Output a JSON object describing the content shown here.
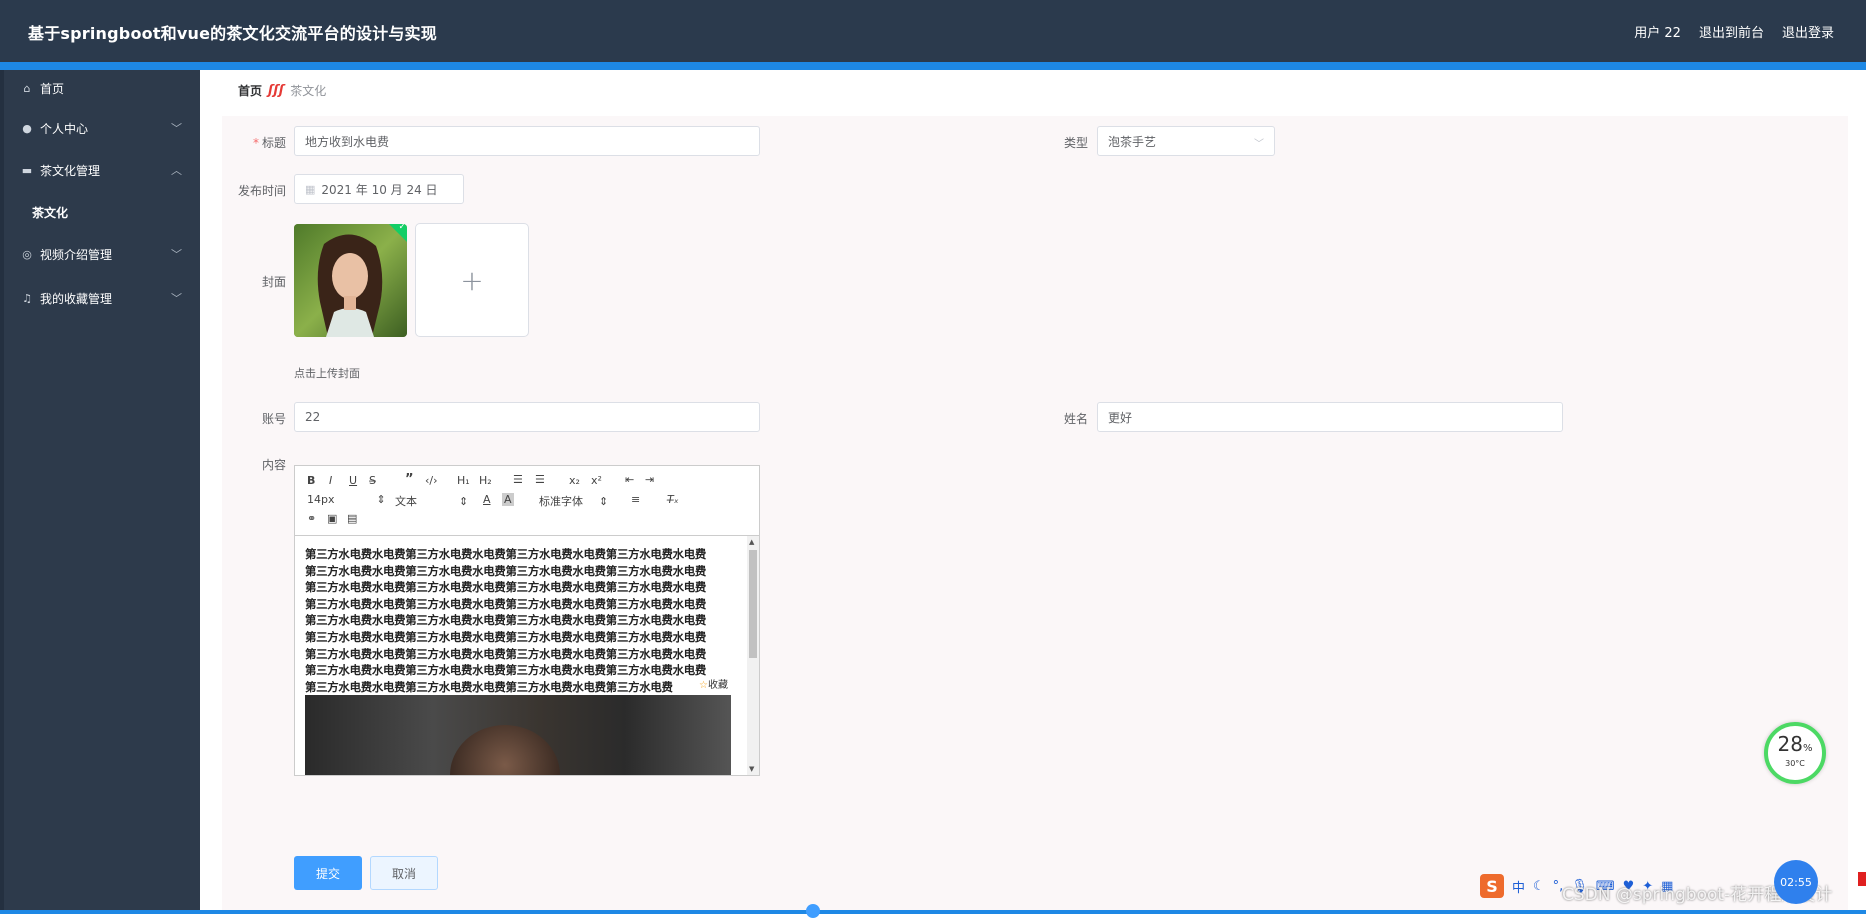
{
  "header": {
    "title": "基于springboot和vue的茶文化交流平台的设计与实现",
    "user": "用户 22",
    "to_front": "退出到前台",
    "logout": "退出登录"
  },
  "sidebar": {
    "items": [
      {
        "label": "首页",
        "icon": "home-icon"
      },
      {
        "label": "个人中心",
        "icon": "user-icon"
      },
      {
        "label": "茶文化管理",
        "icon": "folder-icon"
      },
      {
        "label": "茶文化",
        "icon": ""
      },
      {
        "label": "视频介绍管理",
        "icon": "video-icon"
      },
      {
        "label": "我的收藏管理",
        "icon": "bell-icon"
      }
    ]
  },
  "breadcrumb": {
    "home": "首页",
    "current": "茶文化"
  },
  "form": {
    "title_label": "标题",
    "title_value": "地方收到水电费",
    "type_label": "类型",
    "type_value": "泡茶手艺",
    "date_label": "发布时间",
    "date_value": "2021 年 10 月 24 日",
    "cover_label": "封面",
    "cover_hint": "点击上传封面",
    "account_label": "账号",
    "account_value": "22",
    "name_label": "姓名",
    "name_value": "更好",
    "content_label": "内容"
  },
  "editor": {
    "font_size": "14px",
    "format": "文本",
    "font": "标准字体",
    "lines": [
      "第三方水电费水电费第三方水电费水电费第三方水电费水电费第三方水电费水电费",
      "第三方水电费水电费第三方水电费水电费第三方水电费水电费第三方水电费水电费",
      "第三方水电费水电费第三方水电费水电费第三方水电费水电费第三方水电费水电费",
      "第三方水电费水电费第三方水电费水电费第三方水电费水电费第三方水电费水电费",
      "第三方水电费水电费第三方水电费水电费第三方水电费水电费第三方水电费水电费",
      "第三方水电费水电费第三方水电费水电费第三方水电费水电费第三方水电费水电费",
      "第三方水电费水电费第三方水电费水电费第三方水电费水电费第三方水电费水电费",
      "第三方水电费水电费第三方水电费水电费第三方水电费水电费第三方水电费水电费",
      "第三方水电费水电费第三方水电费水电费第三方水电费水电费第三方水电费"
    ],
    "fav_label": "收藏"
  },
  "buttons": {
    "submit": "提交",
    "cancel": "取消"
  },
  "widget": {
    "percent": "28",
    "percent_unit": "%",
    "temp": "30°C"
  },
  "tray": {
    "ime": "中",
    "clock": "02:55"
  },
  "watermark": "CSDN @springboot-花开程序设计",
  "colors": {
    "header_bg": "#2b3a4d",
    "accent": "#1e88e5",
    "sidebar_bg": "#2d3a4b",
    "primary": "#409eff"
  }
}
